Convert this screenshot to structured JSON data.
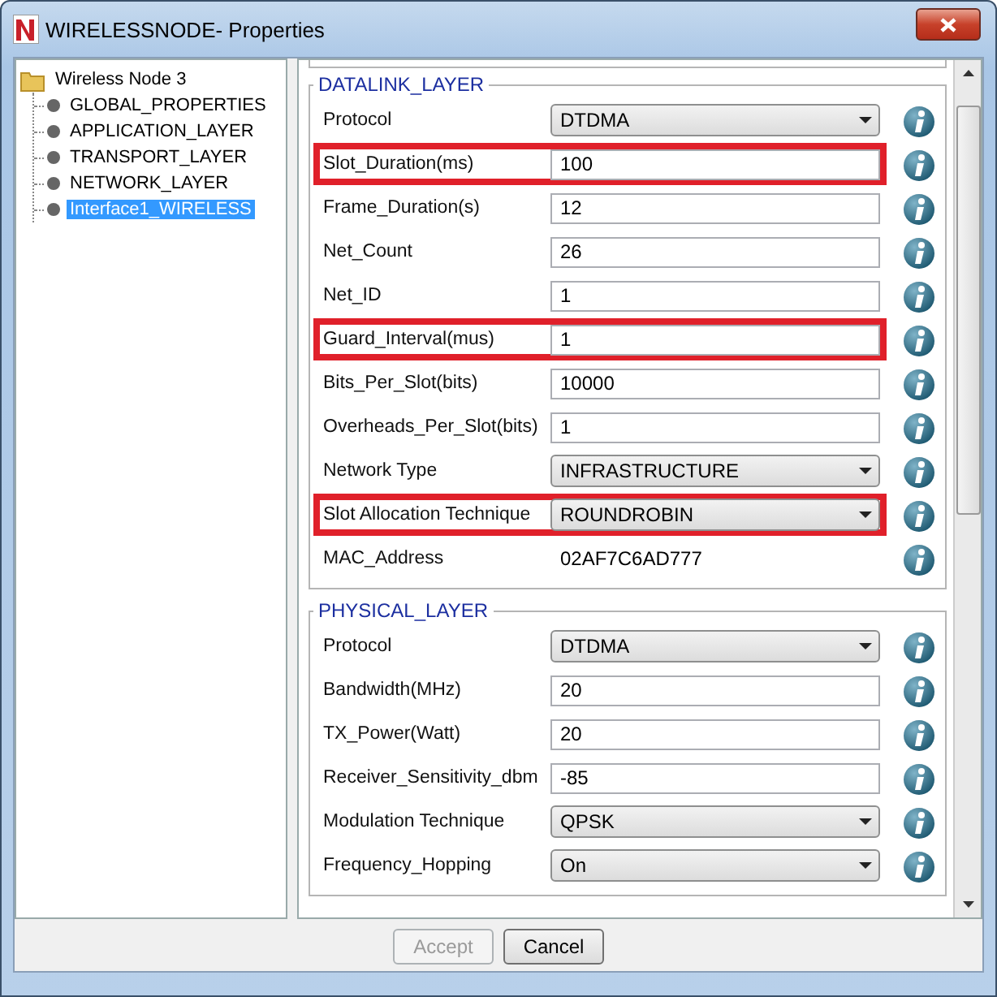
{
  "window": {
    "title": "WIRELESSNODE- Properties"
  },
  "tree": {
    "label": "Wireless Node 3",
    "selected": false,
    "children": [
      {
        "label": "GLOBAL_PROPERTIES",
        "selected": false
      },
      {
        "label": "APPLICATION_LAYER",
        "selected": false
      },
      {
        "label": "TRANSPORT_LAYER",
        "selected": false
      },
      {
        "label": "NETWORK_LAYER",
        "selected": false
      },
      {
        "label": "Interface1_WIRELESS",
        "selected": true
      }
    ]
  },
  "groups": [
    {
      "title": "DATALINK_LAYER",
      "rows": [
        {
          "kind": "select",
          "label": "Protocol",
          "value": "DTDMA",
          "highlighted": false
        },
        {
          "kind": "text",
          "label": "Slot_Duration(ms)",
          "value": "100",
          "highlighted": true
        },
        {
          "kind": "text",
          "label": "Frame_Duration(s)",
          "value": "12",
          "highlighted": false
        },
        {
          "kind": "text",
          "label": "Net_Count",
          "value": "26",
          "highlighted": false
        },
        {
          "kind": "text",
          "label": "Net_ID",
          "value": "1",
          "highlighted": false
        },
        {
          "kind": "text",
          "label": "Guard_Interval(mus)",
          "value": "1",
          "highlighted": true
        },
        {
          "kind": "text",
          "label": "Bits_Per_Slot(bits)",
          "value": "10000",
          "highlighted": false
        },
        {
          "kind": "text",
          "label": "Overheads_Per_Slot(bits)",
          "value": "1",
          "highlighted": false
        },
        {
          "kind": "select",
          "label": "Network Type",
          "value": "INFRASTRUCTURE",
          "highlighted": false
        },
        {
          "kind": "select",
          "label": "Slot Allocation Technique",
          "value": "ROUNDROBIN",
          "highlighted": true
        },
        {
          "kind": "readonly",
          "label": "MAC_Address",
          "value": "02AF7C6AD777",
          "highlighted": false
        }
      ]
    },
    {
      "title": "PHYSICAL_LAYER",
      "rows": [
        {
          "kind": "select",
          "label": "Protocol",
          "value": "DTDMA",
          "highlighted": false
        },
        {
          "kind": "text",
          "label": "Bandwidth(MHz)",
          "value": "20",
          "highlighted": false
        },
        {
          "kind": "text",
          "label": "TX_Power(Watt)",
          "value": "20",
          "highlighted": false
        },
        {
          "kind": "text",
          "label": "Receiver_Sensitivity_dbm",
          "value": "-85",
          "highlighted": false
        },
        {
          "kind": "select",
          "label": "Modulation Technique",
          "value": "QPSK",
          "highlighted": false
        },
        {
          "kind": "select",
          "label": "Frequency_Hopping",
          "value": "On",
          "highlighted": false
        }
      ]
    }
  ],
  "buttons": [
    {
      "label": "Accept",
      "disabled": true
    },
    {
      "label": "Cancel",
      "disabled": false
    }
  ]
}
